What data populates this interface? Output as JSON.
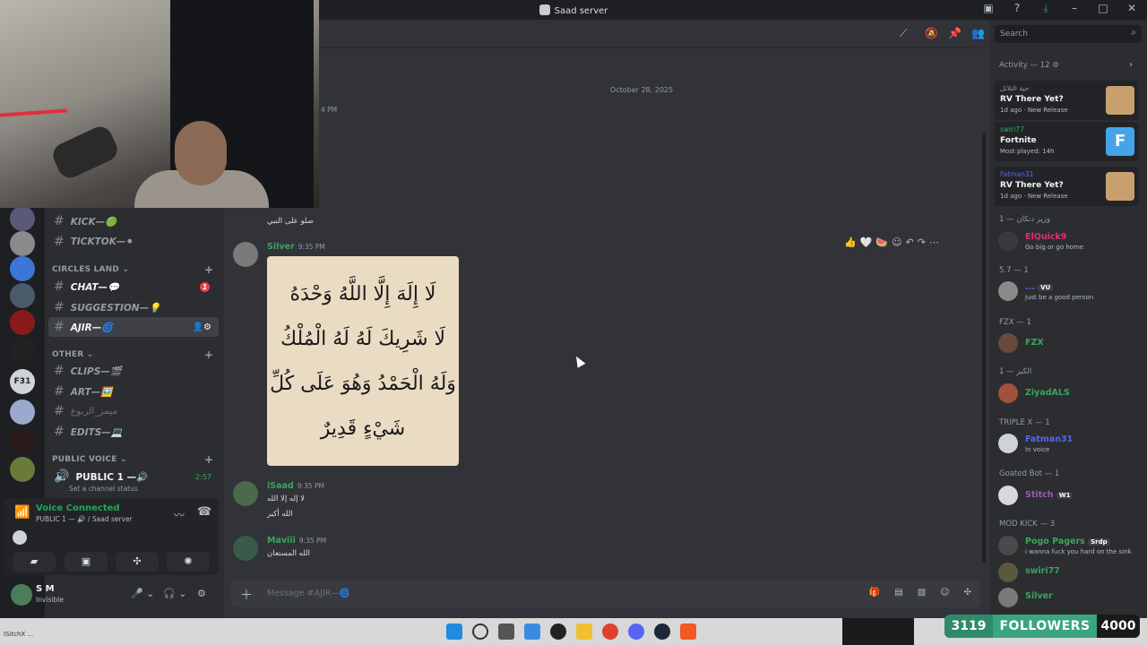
{
  "window": {
    "title": "Saad server"
  },
  "channels": {
    "top_items": [
      {
        "label": "KICK—🟢"
      },
      {
        "label": "TICKTOK—⚫"
      }
    ],
    "cat_circles": "CIRCLES LAND",
    "circles_items": [
      {
        "label": "CHAT—💬",
        "badge": "1"
      },
      {
        "label": "SUGGESTION—💡"
      },
      {
        "label": "AJIR—🌀"
      }
    ],
    "cat_other": "OTHER",
    "other_items": [
      {
        "label": "CLIPS—🎬"
      },
      {
        "label": "ART—🖼️"
      },
      {
        "label": "ميمز_الربوع"
      },
      {
        "label": "EDITS—💻"
      }
    ],
    "cat_voice": "PUBLIC VOICE",
    "voice_channel": "PUBLIC 1 —🔊",
    "voice_timer": "2:57",
    "voice_status": "Set a channel status"
  },
  "voice": {
    "connected": "Voice Connected",
    "sub": "PUBLIC 1 — 🔊 / Saad server"
  },
  "user": {
    "name": "S M",
    "status": "Invisible"
  },
  "chat": {
    "date_divider": "October 28, 2025",
    "time_top": "4 PM",
    "msg0_line": "صلو على النبي",
    "messages": [
      {
        "author": "Silver",
        "time": "9:35 PM",
        "color": "#3ba55c"
      },
      {
        "author": "iSaad",
        "time": "9:35 PM",
        "color": "#3ba55c",
        "lines": [
          "لا إله إلا الله",
          "الله أكبر"
        ]
      },
      {
        "author": "Maviii",
        "time": "9:35 PM",
        "color": "#3ba55c",
        "lines": [
          "الله المستعان"
        ]
      }
    ],
    "image_lines": [
      "لَا إِلَهَ إِلَّا اللَّهُ وَحْدَهُ",
      "لَا شَرِيكَ لَهُ لَهُ الْمُلْكُ",
      "وَلَهُ الْحَمْدُ وَهُوَ عَلَى كُلِّ",
      "شَيْءٍ قَدِيرٌ"
    ],
    "input_placeholder": "Message #AJIR—🌀"
  },
  "right": {
    "search_placeholder": "Search",
    "activity_header": "Activity — 12",
    "activities": [
      {
        "user": "حية التلاتل",
        "game": "RV There Yet?",
        "sub": "1d ago · New Release"
      },
      {
        "user": "swiri77",
        "game": "Fortnite",
        "sub": "Most played: 14h"
      },
      {
        "user": "Fatman31",
        "game": "RV There Yet?",
        "sub": "1d ago · New Release"
      }
    ],
    "members": [
      {
        "role": "وزير دنكان — 1",
        "name": "ElQuick9",
        "status": "Go big or go home",
        "color": "#e0306a"
      },
      {
        "role": "5.7 — 1",
        "name": "...",
        "status": "just be a good person",
        "color": "#5865f2",
        "tag": "VU"
      },
      {
        "role": "FZX — 1",
        "name": "FZX",
        "status": "",
        "color": "#3ba55c"
      },
      {
        "role": "الكبر — 1",
        "name": "ZiyadALS",
        "status": "",
        "color": "#3ba55c"
      },
      {
        "role": "TRIPLE X — 1",
        "name": "Fatman31",
        "status": "In voice",
        "color": "#5865f2"
      },
      {
        "role": "Goated Bot — 1",
        "name": "Stitch",
        "status": "",
        "color": "#9b59b6",
        "tag": "W1"
      },
      {
        "role": "MOD KICK — 3",
        "name": "Pogo Pagers",
        "status": "i wanna fuck you hard on the sink",
        "color": "#3ba55c",
        "tag": "Srdp"
      },
      {
        "role": "",
        "name": "swiri77",
        "status": "",
        "color": "#3ba55c"
      },
      {
        "role": "",
        "name": "Silver",
        "status": "",
        "color": "#3ba55c"
      }
    ]
  },
  "taskbar": {
    "left_text": "ISitchX ...",
    "followers_count": "3119",
    "followers_label": "FOLLOWERS",
    "followers_goal": "4000"
  }
}
